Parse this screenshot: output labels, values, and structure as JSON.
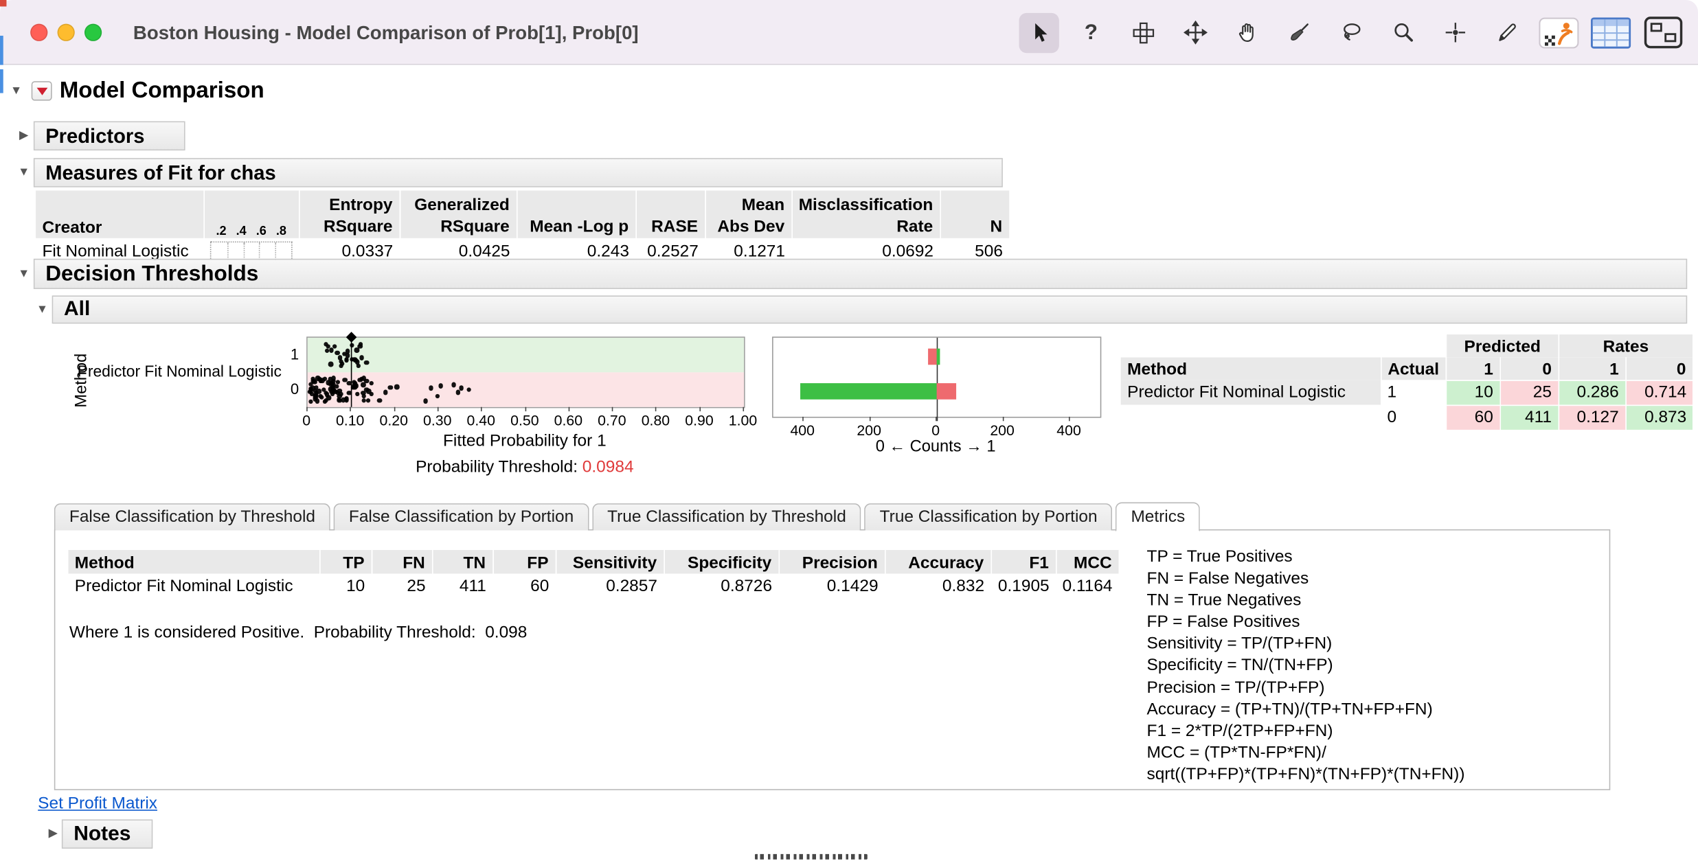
{
  "window": {
    "title": "Boston Housing - Model Comparison of Prob[1], Prob[0]"
  },
  "toolbar": {
    "tools": [
      {
        "name": "cursor",
        "active": true
      },
      {
        "name": "help"
      },
      {
        "name": "window-grid"
      },
      {
        "name": "move"
      },
      {
        "name": "hand"
      },
      {
        "name": "brush"
      },
      {
        "name": "lasso"
      },
      {
        "name": "zoom"
      },
      {
        "name": "crosshair"
      },
      {
        "name": "pencil"
      },
      {
        "name": "jmp-home"
      },
      {
        "name": "data-table"
      },
      {
        "name": "display-box"
      }
    ]
  },
  "outline": {
    "model_comparison": "Model Comparison",
    "predictors": "Predictors",
    "measures": "Measures of Fit for chas",
    "decision_thresholds": "Decision Thresholds",
    "all": "All",
    "notes": "Notes"
  },
  "fit_table": {
    "creator_header": "Creator",
    "plot_axis_ticks": [
      ".2",
      ".4",
      ".6",
      ".8"
    ],
    "columns": [
      {
        "l1": "Entropy",
        "l2": "RSquare"
      },
      {
        "l1": "Generalized",
        "l2": "RSquare"
      },
      {
        "l1": "",
        "l2": "Mean -Log p"
      },
      {
        "l1": "",
        "l2": "RASE"
      },
      {
        "l1": "Mean",
        "l2": "Abs Dev"
      },
      {
        "l1": "Misclassification",
        "l2": "Rate"
      },
      {
        "l1": "",
        "l2": "N"
      }
    ],
    "row": {
      "creator": "Fit Nominal Logistic",
      "values": [
        "0.0337",
        "0.0425",
        "0.243",
        "0.2527",
        "0.1271",
        "0.0692",
        "506"
      ]
    }
  },
  "chart_data": [
    {
      "type": "scatter",
      "xlabel": "Fitted Probability for 1",
      "ylabel": "Method",
      "series_label": "Predictor Fit Nominal Logistic",
      "y_categories": [
        "1",
        "0"
      ],
      "x_ticks": [
        "0",
        "0.10",
        "0.20",
        "0.30",
        "0.40",
        "0.50",
        "0.60",
        "0.70",
        "0.80",
        "0.90",
        "1.00"
      ],
      "xlim": [
        0,
        1
      ],
      "threshold": 0.0984,
      "rows": [
        {
          "label": "1",
          "band_color": "#e2f3e0",
          "n_dense": 26,
          "dense_range": [
            0.035,
            0.125
          ],
          "extras": [
            0.135
          ]
        },
        {
          "label": "0",
          "band_color": "#fce4e6",
          "n_dense": 82,
          "dense_range": [
            0.006,
            0.15
          ],
          "extras": [
            0.165,
            0.178,
            0.19,
            0.205,
            0.27,
            0.283,
            0.298,
            0.305,
            0.335,
            0.345,
            0.352,
            0.37
          ]
        }
      ]
    },
    {
      "type": "bar",
      "xlabel": "0 ← Counts → 1",
      "axis_ticks": [
        "400",
        "200",
        "0",
        "200",
        "400"
      ],
      "tick_values": [
        -400,
        -200,
        0,
        200,
        400
      ],
      "xmax": 400,
      "rows": [
        {
          "actual": "1",
          "left": {
            "value": 25,
            "color": "#ee6a6e"
          },
          "right": {
            "value": 10,
            "color": "#3dbf44"
          }
        },
        {
          "actual": "0",
          "left": {
            "value": 411,
            "color": "#3dbf44"
          },
          "right": {
            "value": 60,
            "color": "#ee6a6e"
          }
        }
      ]
    }
  ],
  "threshold": {
    "label": "Probability Threshold:",
    "value": "0.0984"
  },
  "confusion": {
    "method_header": "Method",
    "actual_header": "Actual",
    "predicted_header": "Predicted",
    "rates_header": "Rates",
    "pred_cols": [
      "1",
      "0"
    ],
    "rate_cols": [
      "1",
      "0"
    ],
    "colors": {
      "green": "#cdf0cf",
      "pink": "#fbd6d9"
    },
    "rows": [
      {
        "method": "Predictor Fit Nominal Logistic",
        "actual": "1",
        "cells": [
          {
            "v": "10",
            "c": "green"
          },
          {
            "v": "25",
            "c": "pink"
          },
          {
            "v": "0.286",
            "c": "green"
          },
          {
            "v": "0.714",
            "c": "pink"
          }
        ]
      },
      {
        "method": "",
        "actual": "0",
        "cells": [
          {
            "v": "60",
            "c": "pink"
          },
          {
            "v": "411",
            "c": "green"
          },
          {
            "v": "0.127",
            "c": "pink"
          },
          {
            "v": "0.873",
            "c": "green"
          }
        ]
      }
    ]
  },
  "tabs": {
    "active": 4,
    "items": [
      "False Classification by Threshold",
      "False Classification by Portion",
      "True Classification by Threshold",
      "True Classification by Portion",
      "Metrics"
    ]
  },
  "metrics": {
    "headers": [
      "Method",
      "TP",
      "FN",
      "TN",
      "FP",
      "Sensitivity",
      "Specificity",
      "Precision",
      "Accuracy",
      "F1",
      "MCC"
    ],
    "row": [
      "Predictor Fit Nominal Logistic",
      "10",
      "25",
      "411",
      "60",
      "0.2857",
      "0.8726",
      "0.1429",
      "0.832",
      "0.1905",
      "0.1164"
    ],
    "note": "Where 1 is considered Positive.  Probability Threshold:  0.098",
    "legend": [
      "TP = True Positives",
      "FN = False Negatives",
      "TN = True Negatives",
      "FP = False Positives",
      "Sensitivity = TP/(TP+FN)",
      "Specificity = TN/(TN+FP)",
      "Precision = TP/(TP+FP)",
      "Accuracy = (TP+TN)/(TP+TN+FP+FN)",
      "F1 = 2*TP/(2TP+FP+FN)",
      "MCC = (TP*TN-FP*FN)/",
      "sqrt((TP+FP)*(TP+FN)*(TN+FP)*(TN+FN))"
    ]
  },
  "profit_link": "Set Profit Matrix"
}
